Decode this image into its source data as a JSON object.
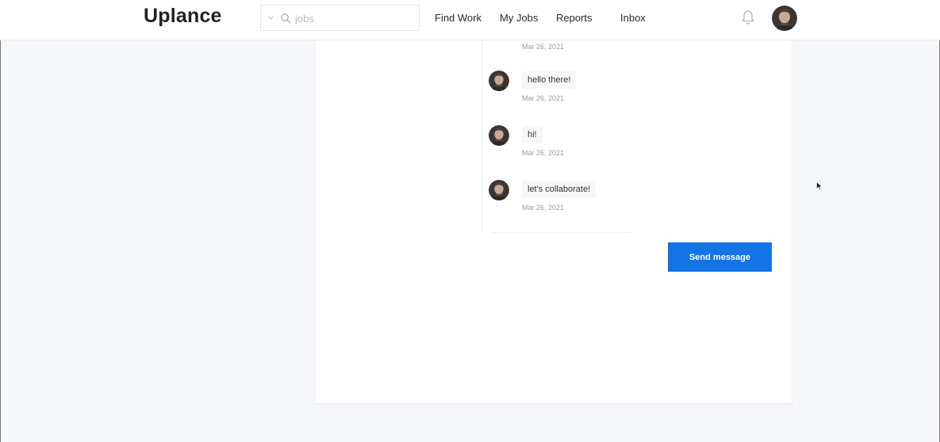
{
  "header": {
    "logo": "Uplance",
    "search": {
      "value": "",
      "placeholder": "jobs"
    },
    "nav": [
      {
        "label": "Find Work"
      },
      {
        "label": "My Jobs"
      },
      {
        "label": "Reports"
      },
      {
        "label": "Inbox"
      }
    ]
  },
  "conversation": {
    "top_timestamp": "Mar 26, 2021",
    "messages": [
      {
        "text": "hello there!",
        "timestamp": "Mar 26, 2021"
      },
      {
        "text": "hi!",
        "timestamp": "Mar 26, 2021"
      },
      {
        "text": "let's collaborate!",
        "timestamp": "Mar 26, 2021"
      }
    ]
  },
  "actions": {
    "send_label": "Send message"
  },
  "colors": {
    "accent": "#1473e6",
    "page_bg": "#f4f6f9"
  }
}
